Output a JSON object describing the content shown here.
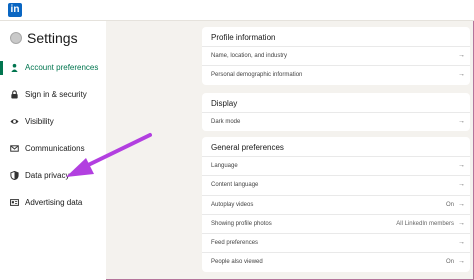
{
  "app": {
    "logo_text": "in"
  },
  "sidebar": {
    "title": "Settings",
    "items": [
      {
        "label": "Account preferences",
        "icon": "person-icon",
        "active": true
      },
      {
        "label": "Sign in & security",
        "icon": "lock-icon"
      },
      {
        "label": "Visibility",
        "icon": "eye-icon"
      },
      {
        "label": "Communications",
        "icon": "envelope-icon"
      },
      {
        "label": "Data privacy",
        "icon": "shield-icon"
      },
      {
        "label": "Advertising data",
        "icon": "id-card-icon"
      }
    ]
  },
  "main": {
    "sections": [
      {
        "title": "Profile information",
        "rows": [
          {
            "label": "Name, location, and industry",
            "value": ""
          },
          {
            "label": "Personal demographic information",
            "value": ""
          }
        ]
      },
      {
        "title": "Display",
        "rows": [
          {
            "label": "Dark mode",
            "value": ""
          }
        ]
      },
      {
        "title": "General preferences",
        "rows": [
          {
            "label": "Language",
            "value": ""
          },
          {
            "label": "Content language",
            "value": ""
          },
          {
            "label": "Autoplay videos",
            "value": "On"
          },
          {
            "label": "Showing profile photos",
            "value": "All LinkedIn members"
          },
          {
            "label": "Feed preferences",
            "value": ""
          },
          {
            "label": "People also viewed",
            "value": "On"
          }
        ]
      }
    ],
    "arrow_glyph": "→"
  },
  "colors": {
    "accent": "#01754f",
    "brand": "#0a66c2",
    "annotation_arrow": "#b23fe0"
  }
}
